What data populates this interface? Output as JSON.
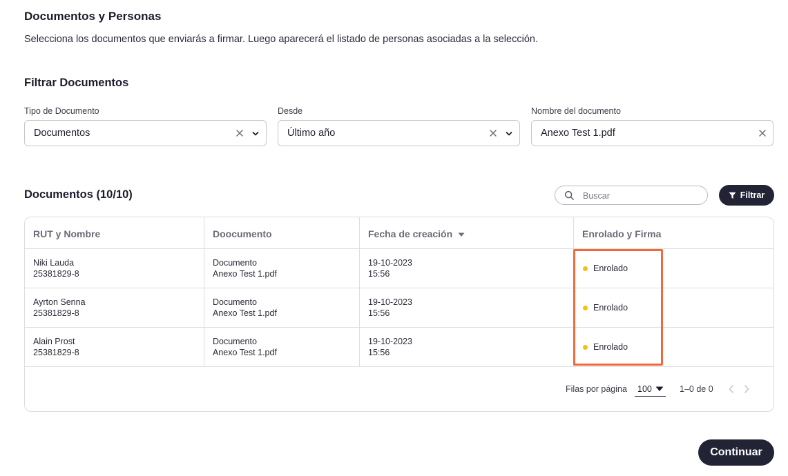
{
  "header": {
    "title": "Documentos y Personas",
    "subtitle": "Selecciona los documentos que enviarás a firmar. Luego aparecerá el listado de personas asociadas a la selección."
  },
  "filters": {
    "title": "Filtrar Documentos",
    "tipo": {
      "label": "Tipo de Documento",
      "value": "Documentos"
    },
    "desde": {
      "label": "Desde",
      "value": "Último año"
    },
    "nombre": {
      "label": "Nombre del documento",
      "value": "Anexo Test 1.pdf"
    }
  },
  "documents": {
    "title": "Documentos (10/10)",
    "search_placeholder": "Buscar",
    "filter_button": "Filtrar",
    "columns": [
      "RUT y Nombre",
      "Doocumento",
      "Fecha de creación",
      "Enrolado y Firma"
    ],
    "rows": [
      {
        "name": "Niki Lauda",
        "rut": "25381829-8",
        "doc_type": "Documento",
        "doc_name": "Anexo Test 1.pdf",
        "date": "19-10-2023",
        "time": "15:56",
        "status": "Enrolado"
      },
      {
        "name": "Ayrton Senna",
        "rut": "25381829-8",
        "doc_type": "Documento",
        "doc_name": "Anexo Test 1.pdf",
        "date": "19-10-2023",
        "time": "15:56",
        "status": "Enrolado"
      },
      {
        "name": "Alain Prost",
        "rut": "25381829-8",
        "doc_type": "Documento",
        "doc_name": "Anexo Test 1.pdf",
        "date": "19-10-2023",
        "time": "15:56",
        "status": "Enrolado"
      }
    ]
  },
  "pagination": {
    "rows_label": "Filas por página",
    "rows_value": "100",
    "range": "1–0 de 0"
  },
  "actions": {
    "continue": "Continuar"
  },
  "colors": {
    "accent": "#232336",
    "status_dot": "#f4c20d",
    "highlight": "#f06a3a"
  }
}
